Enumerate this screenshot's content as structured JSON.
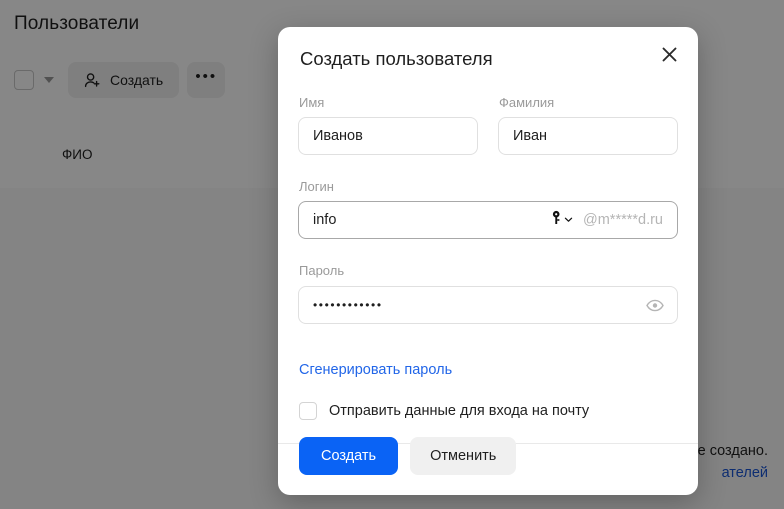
{
  "background": {
    "page_title": "Пользователи",
    "toolbar": {
      "select_all_checkbox": "",
      "dropdown_caret_icon": "chevron-down-icon",
      "create_button_label": "Создать",
      "create_button_icon": "user-add-icon",
      "more_button_label": "•••"
    },
    "table": {
      "columns": [
        "ФИО"
      ]
    },
    "empty_state": {
      "line1": "е создано.",
      "link": "ателей"
    }
  },
  "modal": {
    "title": "Создать пользователя",
    "close_icon": "close-icon",
    "fields": {
      "first_name": {
        "label": "Имя",
        "value": "Иванов"
      },
      "last_name": {
        "label": "Фамилия",
        "value": "Иван"
      },
      "login": {
        "label": "Логин",
        "value": "info",
        "domain_suffix": "@m*****d.ru",
        "key_icon": "key-icon",
        "caret_icon": "chevron-down-icon"
      },
      "password": {
        "label": "Пароль",
        "value": "••••••••••••",
        "toggle_icon": "eye-icon"
      }
    },
    "generate_password_link": "Сгенерировать пароль",
    "send_credentials": {
      "label": "Отправить данные для входа на почту",
      "checked": false
    },
    "buttons": {
      "submit": "Создать",
      "cancel": "Отменить"
    },
    "colors": {
      "primary": "#0a63f5",
      "link": "#2266e8",
      "secondary_bg": "#f0f0f0"
    }
  }
}
